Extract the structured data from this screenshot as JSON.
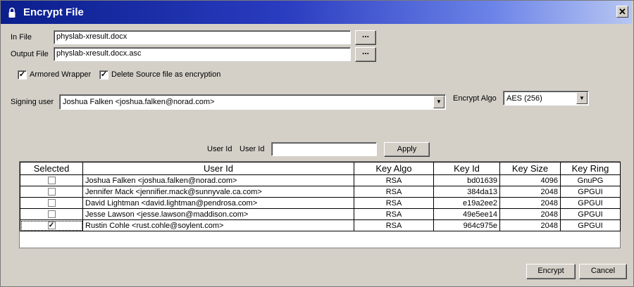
{
  "window": {
    "title": "Encrypt File",
    "close_label": "✕"
  },
  "in_file": {
    "label": "In File",
    "value": "physlab-xresult.docx",
    "browse_label": "..."
  },
  "output_file": {
    "label": "Output File",
    "value": "physlab-xresult.docx.asc",
    "browse_label": "..."
  },
  "options": {
    "armored_wrapper": {
      "label": "Armored Wrapper",
      "checked": true
    },
    "delete_source": {
      "label": "Delete Source file as encryption",
      "checked": true
    }
  },
  "signing_user": {
    "label": "Signing user",
    "value": "Joshua Falken <joshua.falken@norad.com>"
  },
  "encrypt_algo": {
    "label": "Encrypt Algo",
    "value": "AES (256)"
  },
  "filter": {
    "label1": "User Id",
    "label2": "User Id",
    "value": "",
    "apply_label": "Apply"
  },
  "table": {
    "headers": [
      "Selected",
      "User Id",
      "Key Algo",
      "Key Id",
      "Key Size",
      "Key Ring"
    ],
    "rows": [
      {
        "selected": false,
        "user_id": "Joshua Falken <joshua.falken@norad.com>",
        "algo": "RSA",
        "key_id": "bd01639",
        "size": "4096",
        "ring": "GnuPG"
      },
      {
        "selected": false,
        "user_id": "Jennifer Mack <jennifier.mack@sunnyvale.ca.com>",
        "algo": "RSA",
        "key_id": "384da13",
        "size": "2048",
        "ring": "GPGUI"
      },
      {
        "selected": false,
        "user_id": "David Lightman <david.lightman@pendrosa.com>",
        "algo": "RSA",
        "key_id": "e19a2ee2",
        "size": "2048",
        "ring": "GPGUI"
      },
      {
        "selected": false,
        "user_id": "Jesse Lawson <jesse.lawson@maddison.com>",
        "algo": "RSA",
        "key_id": "49e5ee14",
        "size": "2048",
        "ring": "GPGUI"
      },
      {
        "selected": true,
        "user_id": "Rustin Cohle <rust.cohle@soylent.com>",
        "algo": "RSA",
        "key_id": "964c975e",
        "size": "2048",
        "ring": "GPGUI"
      }
    ]
  },
  "actions": {
    "encrypt_label": "Encrypt",
    "cancel_label": "Cancel"
  }
}
